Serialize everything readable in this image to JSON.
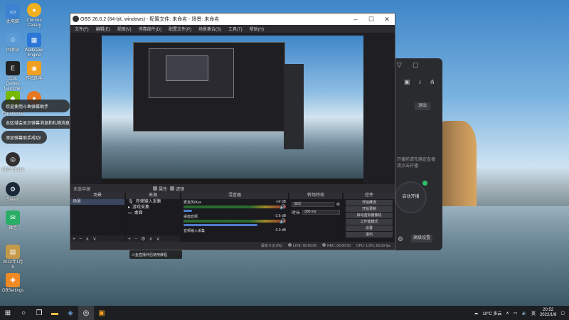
{
  "desktop": {
    "icons": [
      {
        "label": "此电脑",
        "icon": "computer-icon",
        "color": "#3b82d1"
      },
      {
        "label": "Chrome Canary",
        "icon": "chrome-canary-icon",
        "color": "#f2b01e"
      },
      {
        "label": "回收站",
        "icon": "recycle-bin-icon",
        "color": "#5a9bd5"
      },
      {
        "label": "Wallpaper Engine",
        "icon": "wallpaper-engine-icon",
        "color": "#2b76d6"
      },
      {
        "label": "Epic Games Launcher",
        "icon": "epic-games-icon",
        "color": "#222222"
      },
      {
        "label": "FPS助手",
        "icon": "fps-icon",
        "color": "#f0a020"
      },
      {
        "label": "GeForce Experience",
        "icon": "geforce-icon",
        "color": "#76b900"
      },
      {
        "label": "",
        "icon": "orange-app-icon",
        "color": "#e87722"
      },
      {
        "label": "OBS Studio",
        "icon": "obs-icon",
        "color": "#302e31"
      },
      {
        "label": "Steam",
        "icon": "steam-icon",
        "color": "#1b2838"
      },
      {
        "label": "微信",
        "icon": "wechat-icon",
        "color": "#2aae67"
      },
      {
        "label": "2022年1月8",
        "icon": "folder-icon",
        "color": "#c49a4a"
      },
      {
        "label": "OBSettings",
        "icon": "settings-app-icon",
        "color": "#f08a24"
      }
    ],
    "notifications": [
      "欢迎使用斗鱼弹幕助手",
      "本区域会显示弹幕消息和礼物消息",
      "添加弹幕助手成功!"
    ],
    "mini_banner": "斗鱼直播伴侣使用教程"
  },
  "side_app": {
    "top_button": "退出",
    "start_label": "启动开播",
    "hint1": "开播前请先确定直播",
    "hint2": "请点击开播",
    "bottom_button": "高级设置"
  },
  "obs": {
    "title": "OBS 26.0.2 (64-bit, windows) - 配置文件: 未命名 - 场景: 未命名",
    "menu": [
      "文件(F)",
      "编辑(E)",
      "视图(V)",
      "停靠部件(D)",
      "配置文件(P)",
      "场景集合(S)",
      "工具(T)",
      "帮助(H)"
    ],
    "dock_status": "未选中源",
    "dock_props": "属性",
    "dock_filters": "滤镜",
    "scenes": {
      "title": "场景",
      "items": [
        "场景"
      ]
    },
    "sources": {
      "title": "来源",
      "items": [
        "音频输入采集",
        "游戏采集",
        "桌面"
      ]
    },
    "mixer": {
      "title": "混音器",
      "channels": [
        {
          "name": "麦克风/Aux",
          "db": "-inf dB"
        },
        {
          "name": "桌面音频",
          "db": "-3.6 dB"
        },
        {
          "name": "音频输入采集",
          "db": "0.0 dB"
        }
      ]
    },
    "transitions": {
      "title": "转场特效",
      "mode": "淡出",
      "duration_label": "时长",
      "duration": "300 ms"
    },
    "controls": {
      "title": "控件",
      "buttons": [
        "开始推流",
        "开始录制",
        "启动虚拟摄像机",
        "工作室模式",
        "设置",
        "退出"
      ]
    },
    "status": {
      "dropped": "丢帧 0 (0.0%)",
      "live": "LIVE: 00:00:00",
      "rec": "REC: 00:00:00",
      "cpu": "CPU: 1.5%, 60.00 fps"
    }
  },
  "taskbar": {
    "weather": "10°C 多云",
    "language": "英",
    "time": "20:52",
    "date": "2022/1/8"
  }
}
